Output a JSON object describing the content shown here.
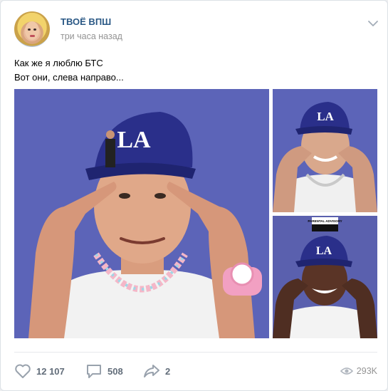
{
  "post": {
    "author": "ТВОЁ ВПШ",
    "time": "три часа назад",
    "text_line1": "Как же я люблю БТС",
    "text_line2": "Вот они, слева направо...",
    "cap_logo": "LA",
    "parental_label": "PARENTAL ADVISORY"
  },
  "footer": {
    "likes": "12 107",
    "comments": "508",
    "shares": "2",
    "views": "293K"
  },
  "colors": {
    "author_link": "#2a5885",
    "photo_background": "#5c64b8",
    "action_gray": "#626d7a"
  },
  "icons": [
    "avatar",
    "chevron-down-icon",
    "heart-icon",
    "comment-icon",
    "share-icon",
    "eye-icon"
  ]
}
